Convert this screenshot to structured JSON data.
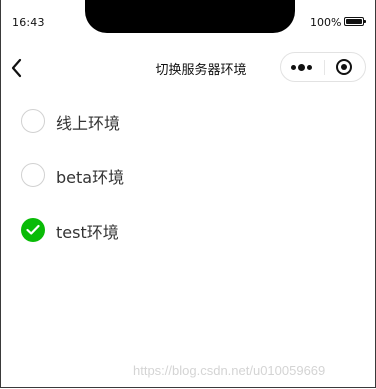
{
  "status_bar": {
    "time": "16:43",
    "battery_text": "100%"
  },
  "nav": {
    "title": "切换服务器环境",
    "back_icon": "chevron-left-icon",
    "more_icon": "more-dots-icon",
    "close_icon": "target-close-icon"
  },
  "env_options": [
    {
      "label": "线上环境",
      "checked": false
    },
    {
      "label": "beta环境",
      "checked": false
    },
    {
      "label": "test环境",
      "checked": true
    }
  ],
  "colors": {
    "accent": "#09bb07",
    "radio_border": "#d1d1d1",
    "label_text": "#333333"
  },
  "watermark": "https://blog.csdn.net/u010059669"
}
